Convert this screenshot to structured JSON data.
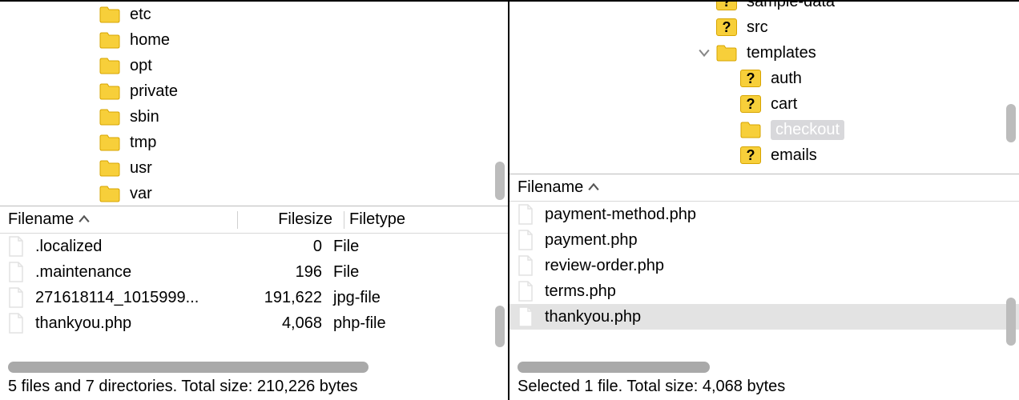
{
  "left": {
    "tree": [
      {
        "label": "etc",
        "kind": "folder",
        "indent": 1
      },
      {
        "label": "home",
        "kind": "folder",
        "indent": 1
      },
      {
        "label": "opt",
        "kind": "folder",
        "indent": 1
      },
      {
        "label": "private",
        "kind": "folder",
        "indent": 1
      },
      {
        "label": "sbin",
        "kind": "folder",
        "indent": 1
      },
      {
        "label": "tmp",
        "kind": "folder",
        "indent": 1
      },
      {
        "label": "usr",
        "kind": "folder",
        "indent": 1
      },
      {
        "label": "var",
        "kind": "folder",
        "indent": 1
      }
    ],
    "columns": {
      "filename": "Filename",
      "filesize": "Filesize",
      "filetype": "Filetype"
    },
    "files": [
      {
        "name": ".localized",
        "size": "0",
        "type": "File"
      },
      {
        "name": ".maintenance",
        "size": "196",
        "type": "File"
      },
      {
        "name": "271618114_1015999...",
        "size": "191,622",
        "type": "jpg-file"
      },
      {
        "name": "thankyou.php",
        "size": "4,068",
        "type": "php-file"
      }
    ],
    "status": "5 files and 7 directories. Total size: 210,226 bytes"
  },
  "right": {
    "tree": [
      {
        "label": "sample-data",
        "kind": "q",
        "indent": 2,
        "cut": true
      },
      {
        "label": "src",
        "kind": "q",
        "indent": 2
      },
      {
        "label": "templates",
        "kind": "folder",
        "indent": 2,
        "expanded": true
      },
      {
        "label": "auth",
        "kind": "q",
        "indent": 3
      },
      {
        "label": "cart",
        "kind": "q",
        "indent": 3
      },
      {
        "label": "checkout",
        "kind": "folder",
        "indent": 3,
        "selected": true
      },
      {
        "label": "emails",
        "kind": "q",
        "indent": 3
      }
    ],
    "columns": {
      "filename": "Filename"
    },
    "files": [
      {
        "name": "payment-method.php"
      },
      {
        "name": "payment.php"
      },
      {
        "name": "review-order.php"
      },
      {
        "name": "terms.php"
      },
      {
        "name": "thankyou.php",
        "selected": true
      }
    ],
    "status": "Selected 1 file. Total size: 4,068 bytes"
  }
}
